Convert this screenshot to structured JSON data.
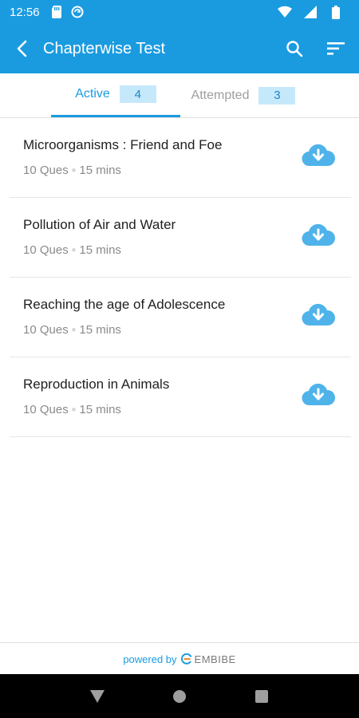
{
  "status_bar": {
    "time": "12:56"
  },
  "app_bar": {
    "title": "Chapterwise Test"
  },
  "tabs": [
    {
      "label": "Active",
      "count": "4"
    },
    {
      "label": "Attempted",
      "count": "3"
    }
  ],
  "tests": [
    {
      "title": "Microorganisms : Friend and Foe",
      "ques": "10 Ques",
      "duration": "15 mins"
    },
    {
      "title": "Pollution of Air and  Water",
      "ques": "10 Ques",
      "duration": "15 mins"
    },
    {
      "title": "Reaching the age of Adolescence",
      "ques": "10 Ques",
      "duration": "15 mins"
    },
    {
      "title": "Reproduction in Animals",
      "ques": "10 Ques",
      "duration": "15 mins"
    }
  ],
  "meta_separator": "◦",
  "footer": {
    "powered_by": "powered by",
    "brand": "EMBIBE"
  },
  "colors": {
    "primary": "#1a9be0",
    "count_bg": "#c6e8fb",
    "download_icon": "#4fb3ea"
  }
}
